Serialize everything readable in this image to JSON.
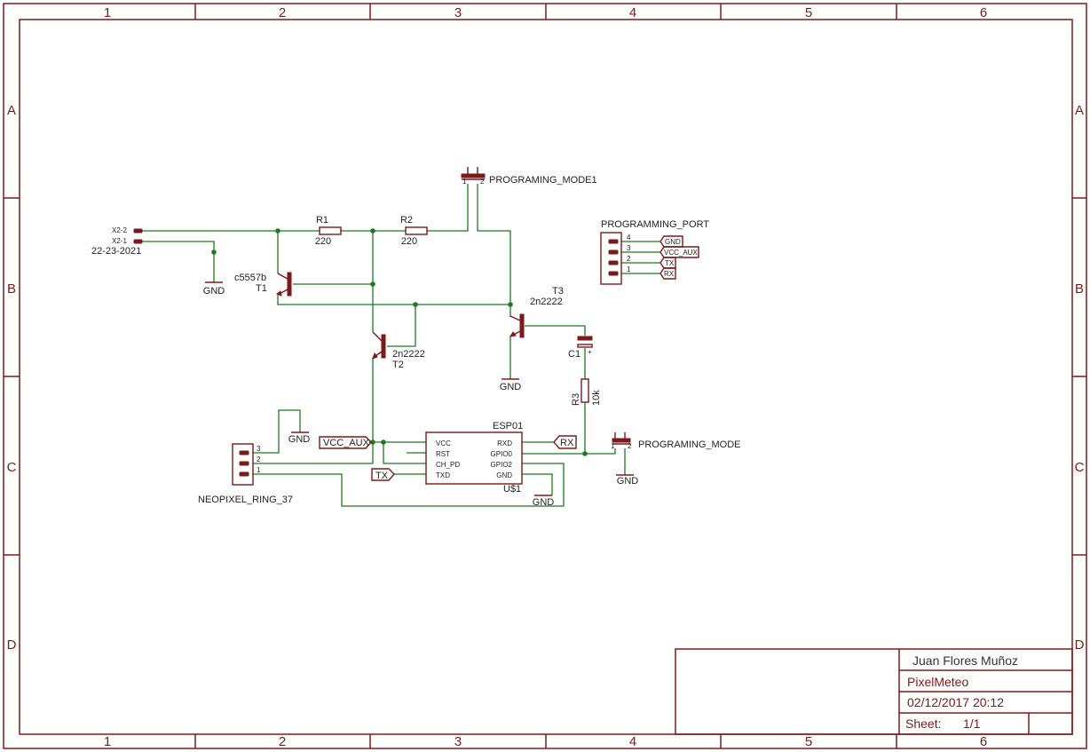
{
  "frame": {
    "columns": [
      "1",
      "2",
      "3",
      "4",
      "5",
      "6"
    ],
    "rows": [
      "A",
      "B",
      "C",
      "D"
    ]
  },
  "title_block": {
    "author": "Juan Flores Muñoz",
    "project": "PixelMeteo",
    "date": "02/12/2017 20:12",
    "sheet_label": "Sheet:",
    "sheet_value": "1/1"
  },
  "components": {
    "x2_pin2": "X2-2",
    "x2_pin1": "X2-1",
    "x2_value": "22-23-2021",
    "r1_name": "R1",
    "r1_value": "220",
    "r2_name": "R2",
    "r2_value": "220",
    "t1_value": "c5557b",
    "t1_name": "T1",
    "t2_value": "2n2222",
    "t2_name": "T2",
    "t3_name": "T3",
    "t3_value": "2n2222",
    "c1_name": "C1",
    "c1_plus": "+",
    "r3_name": "R3",
    "r3_value": "10k",
    "prog_mode1": "PROGRAMING_MODE1",
    "prog_mode": "PROGRAMING_MODE",
    "prog_port": "PROGRAMMING_PORT",
    "neopixel": "NEOPIXEL_RING_37",
    "esp_name": "ESP01",
    "esp_ref": "U$1",
    "jumper_pin1": "1",
    "jumper_pin2": "2"
  },
  "esp_pins": {
    "vcc": "VCC",
    "rst": "RST",
    "ch_pd": "CH_PD",
    "txd": "TXD",
    "rxd": "RXD",
    "gpio0": "GPIO0",
    "gpio2": "GPIO2",
    "gnd": "GND"
  },
  "port_pins": {
    "n4": "4",
    "n3": "3",
    "n2": "2",
    "n1": "1",
    "gnd": "GND",
    "vcc_aux": "VCC_AUX",
    "tx": "TX",
    "rx": "RX"
  },
  "neo_pins": {
    "n3": "3",
    "n2": "2",
    "n1": "1"
  },
  "net_labels": {
    "gnd": "GND",
    "vcc_aux": "VCC_AUX",
    "rx": "RX",
    "tx": "TX"
  },
  "colors": {
    "frame": "#7a1a1a",
    "wire": "#1f7a1f"
  }
}
